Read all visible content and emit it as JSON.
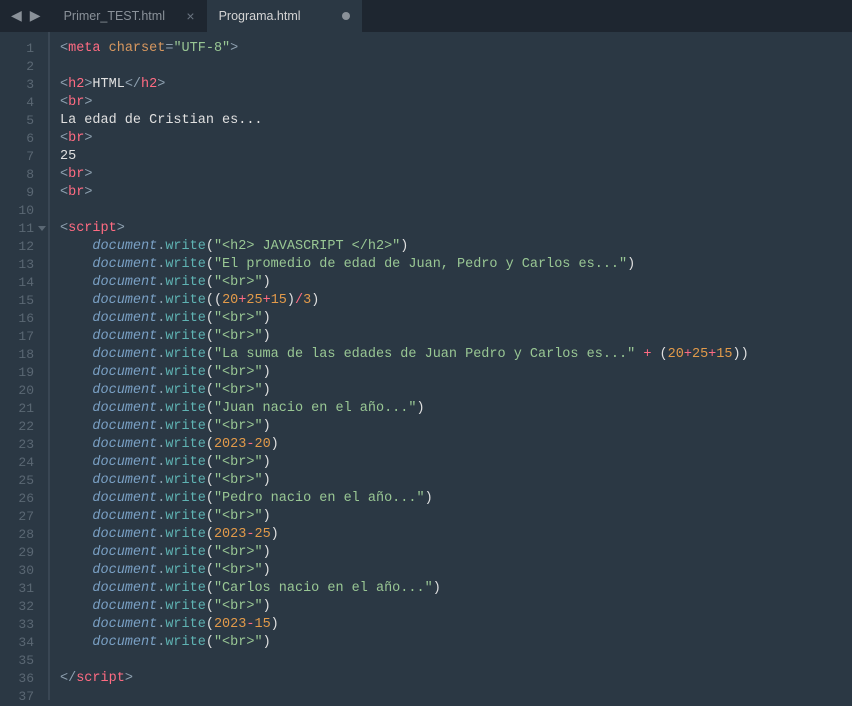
{
  "tabs": [
    {
      "label": "Primer_TEST.html",
      "active": false,
      "modified": false
    },
    {
      "label": "Programa.html",
      "active": true,
      "modified": true
    }
  ],
  "nav": {
    "back": "◀",
    "forward": "▶"
  },
  "lineNumbers": [
    "1",
    "2",
    "3",
    "4",
    "5",
    "6",
    "7",
    "8",
    "9",
    "10",
    "11",
    "12",
    "13",
    "14",
    "15",
    "16",
    "17",
    "18",
    "19",
    "20",
    "21",
    "22",
    "23",
    "24",
    "25",
    "26",
    "27",
    "28",
    "29",
    "30",
    "31",
    "32",
    "33",
    "34",
    "35",
    "36",
    "37"
  ],
  "foldLines": [
    11
  ],
  "code": {
    "l1": {
      "tag_open": "<",
      "tag": "meta",
      "attr": "charset",
      "eq": "=",
      "val": "\"UTF-8\"",
      "close": ">"
    },
    "l3": {
      "open": "<",
      "tag": "h2",
      "c1": ">",
      "text": "HTML",
      "open2": "</",
      "c2": ">"
    },
    "br": {
      "open": "<",
      "tag": "br",
      "close": ">"
    },
    "l5": {
      "text": "La edad de Cristian es..."
    },
    "l7": {
      "text": "25"
    },
    "l11": {
      "open": "<",
      "tag": "script",
      "close": ">"
    },
    "doc": "document",
    "dot": ".",
    "write": "write",
    "lp": "(",
    "rp": ")",
    "s12": "\"<h2> JAVASCRIPT </h2>\"",
    "s13": "\"El promedio de edad de Juan, Pedro y Carlos es...\"",
    "sbr": "\"<br>\"",
    "n15a": "20",
    "n15b": "25",
    "n15c": "15",
    "div": "/",
    "n3": "3",
    "plus": "+",
    "s18a": "\"La suma de las edades de Juan Pedro y Carlos es...\"",
    "s18op": " + ",
    "n18a": "20",
    "n18b": "25",
    "n18c": "15",
    "s21": "\"Juan nacio en el año...\"",
    "n23a": "2023",
    "minus": "-",
    "n23b": "20",
    "s26": "\"Pedro nacio en el año...\"",
    "n28a": "2023",
    "n28b": "25",
    "s31": "\"Carlos nacio en el año...\"",
    "n33a": "2023",
    "n33b": "15",
    "l36": {
      "open": "</",
      "tag": "script",
      "close": ">"
    }
  }
}
